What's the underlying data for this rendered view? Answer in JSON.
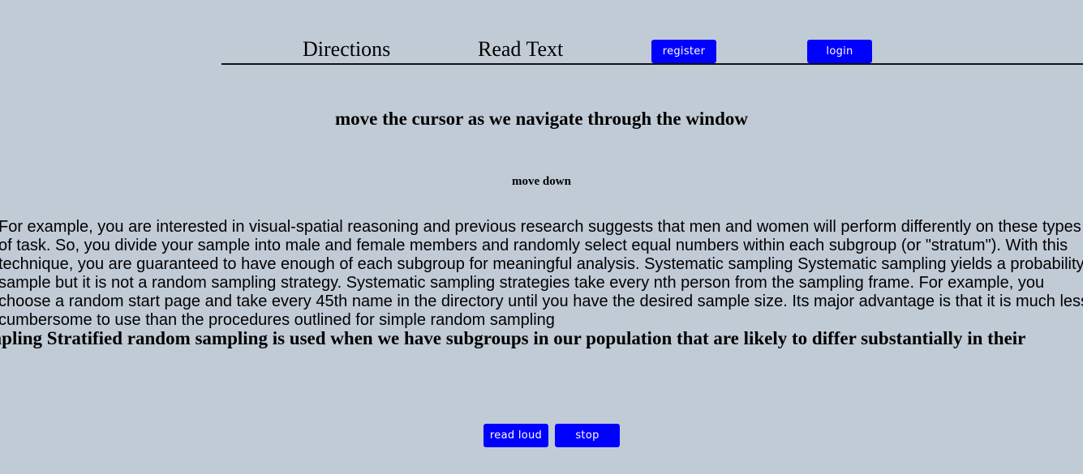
{
  "nav": {
    "directions": "Directions",
    "read_text": "Read Text",
    "register": "register",
    "login": "login"
  },
  "main": {
    "title": "move the cursor as we navigate through the window",
    "subtitle": "move down",
    "paragraph": "For example, you are interested in visual-spatial reasoning and previous research suggests that men and women will perform differently on these types of task. So, you divide your sample into male and female members and randomly select equal numbers within each subgroup (or \"stratum\"). With this technique, you are guaranteed to have enough of each subgroup for meaningful analysis. Systematic sampling Systematic sampling yields a probability sample but it is not a random sampling strategy. Systematic sampling strategies take every nth person from the sampling frame. For example, you choose a random start page and take every 45th name in the directory until you have the desired sample size. Its major advantage is that it is much less cumbersome to use than the procedures outlined for simple random sampling",
    "scrolling_text": "mpling Stratified random sampling is used when we have subgroups in our population that are likely to differ substantially in their"
  },
  "controls": {
    "read_loud": "read loud",
    "stop": "stop"
  },
  "colors": {
    "background": "#c1cbd6",
    "button": "#0000ff"
  }
}
